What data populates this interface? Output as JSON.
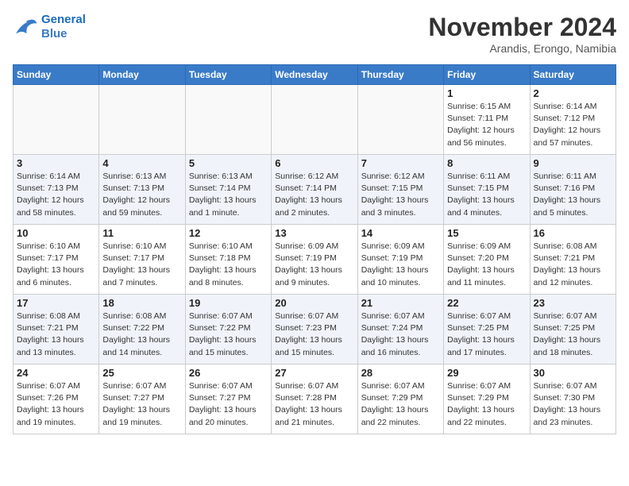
{
  "header": {
    "logo_line1": "General",
    "logo_line2": "Blue",
    "month": "November 2024",
    "location": "Arandis, Erongo, Namibia"
  },
  "weekdays": [
    "Sunday",
    "Monday",
    "Tuesday",
    "Wednesday",
    "Thursday",
    "Friday",
    "Saturday"
  ],
  "weeks": [
    [
      {
        "day": "",
        "info": ""
      },
      {
        "day": "",
        "info": ""
      },
      {
        "day": "",
        "info": ""
      },
      {
        "day": "",
        "info": ""
      },
      {
        "day": "",
        "info": ""
      },
      {
        "day": "1",
        "info": "Sunrise: 6:15 AM\nSunset: 7:11 PM\nDaylight: 12 hours\nand 56 minutes."
      },
      {
        "day": "2",
        "info": "Sunrise: 6:14 AM\nSunset: 7:12 PM\nDaylight: 12 hours\nand 57 minutes."
      }
    ],
    [
      {
        "day": "3",
        "info": "Sunrise: 6:14 AM\nSunset: 7:13 PM\nDaylight: 12 hours\nand 58 minutes."
      },
      {
        "day": "4",
        "info": "Sunrise: 6:13 AM\nSunset: 7:13 PM\nDaylight: 12 hours\nand 59 minutes."
      },
      {
        "day": "5",
        "info": "Sunrise: 6:13 AM\nSunset: 7:14 PM\nDaylight: 13 hours\nand 1 minute."
      },
      {
        "day": "6",
        "info": "Sunrise: 6:12 AM\nSunset: 7:14 PM\nDaylight: 13 hours\nand 2 minutes."
      },
      {
        "day": "7",
        "info": "Sunrise: 6:12 AM\nSunset: 7:15 PM\nDaylight: 13 hours\nand 3 minutes."
      },
      {
        "day": "8",
        "info": "Sunrise: 6:11 AM\nSunset: 7:15 PM\nDaylight: 13 hours\nand 4 minutes."
      },
      {
        "day": "9",
        "info": "Sunrise: 6:11 AM\nSunset: 7:16 PM\nDaylight: 13 hours\nand 5 minutes."
      }
    ],
    [
      {
        "day": "10",
        "info": "Sunrise: 6:10 AM\nSunset: 7:17 PM\nDaylight: 13 hours\nand 6 minutes."
      },
      {
        "day": "11",
        "info": "Sunrise: 6:10 AM\nSunset: 7:17 PM\nDaylight: 13 hours\nand 7 minutes."
      },
      {
        "day": "12",
        "info": "Sunrise: 6:10 AM\nSunset: 7:18 PM\nDaylight: 13 hours\nand 8 minutes."
      },
      {
        "day": "13",
        "info": "Sunrise: 6:09 AM\nSunset: 7:19 PM\nDaylight: 13 hours\nand 9 minutes."
      },
      {
        "day": "14",
        "info": "Sunrise: 6:09 AM\nSunset: 7:19 PM\nDaylight: 13 hours\nand 10 minutes."
      },
      {
        "day": "15",
        "info": "Sunrise: 6:09 AM\nSunset: 7:20 PM\nDaylight: 13 hours\nand 11 minutes."
      },
      {
        "day": "16",
        "info": "Sunrise: 6:08 AM\nSunset: 7:21 PM\nDaylight: 13 hours\nand 12 minutes."
      }
    ],
    [
      {
        "day": "17",
        "info": "Sunrise: 6:08 AM\nSunset: 7:21 PM\nDaylight: 13 hours\nand 13 minutes."
      },
      {
        "day": "18",
        "info": "Sunrise: 6:08 AM\nSunset: 7:22 PM\nDaylight: 13 hours\nand 14 minutes."
      },
      {
        "day": "19",
        "info": "Sunrise: 6:07 AM\nSunset: 7:22 PM\nDaylight: 13 hours\nand 15 minutes."
      },
      {
        "day": "20",
        "info": "Sunrise: 6:07 AM\nSunset: 7:23 PM\nDaylight: 13 hours\nand 15 minutes."
      },
      {
        "day": "21",
        "info": "Sunrise: 6:07 AM\nSunset: 7:24 PM\nDaylight: 13 hours\nand 16 minutes."
      },
      {
        "day": "22",
        "info": "Sunrise: 6:07 AM\nSunset: 7:25 PM\nDaylight: 13 hours\nand 17 minutes."
      },
      {
        "day": "23",
        "info": "Sunrise: 6:07 AM\nSunset: 7:25 PM\nDaylight: 13 hours\nand 18 minutes."
      }
    ],
    [
      {
        "day": "24",
        "info": "Sunrise: 6:07 AM\nSunset: 7:26 PM\nDaylight: 13 hours\nand 19 minutes."
      },
      {
        "day": "25",
        "info": "Sunrise: 6:07 AM\nSunset: 7:27 PM\nDaylight: 13 hours\nand 19 minutes."
      },
      {
        "day": "26",
        "info": "Sunrise: 6:07 AM\nSunset: 7:27 PM\nDaylight: 13 hours\nand 20 minutes."
      },
      {
        "day": "27",
        "info": "Sunrise: 6:07 AM\nSunset: 7:28 PM\nDaylight: 13 hours\nand 21 minutes."
      },
      {
        "day": "28",
        "info": "Sunrise: 6:07 AM\nSunset: 7:29 PM\nDaylight: 13 hours\nand 22 minutes."
      },
      {
        "day": "29",
        "info": "Sunrise: 6:07 AM\nSunset: 7:29 PM\nDaylight: 13 hours\nand 22 minutes."
      },
      {
        "day": "30",
        "info": "Sunrise: 6:07 AM\nSunset: 7:30 PM\nDaylight: 13 hours\nand 23 minutes."
      }
    ]
  ]
}
